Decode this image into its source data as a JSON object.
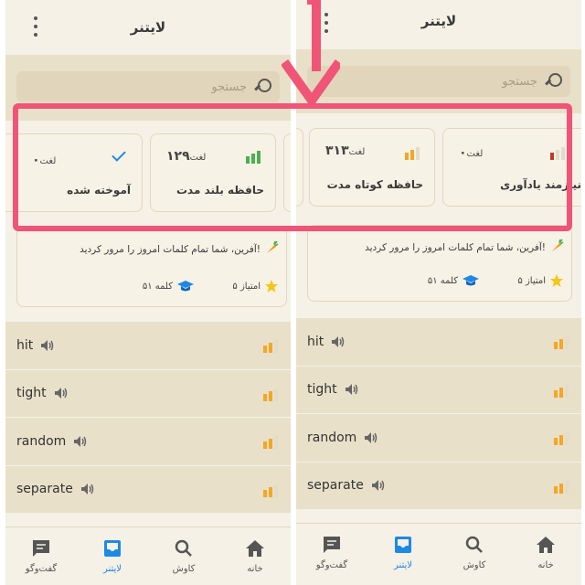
{
  "colors": {
    "accent": "#1e88e5",
    "highlight": "#f05476",
    "green": "#4caf50",
    "orange": "#f5a623",
    "red": "#c0392b"
  },
  "header": {
    "title": "لایتنر"
  },
  "search": {
    "placeholder": "جستجو"
  },
  "left": {
    "cards": [
      {
        "name": "آموخته شده",
        "unit": "لغت",
        "count": "۰",
        "icon": "check-icon"
      },
      {
        "name": "حافظه بلند مدت",
        "unit": "لغت",
        "count": "۱۲۹",
        "icon": "bars-green-icon"
      }
    ]
  },
  "right": {
    "cards": [
      {
        "name": "حافظه کوتاه مدت",
        "unit": "لغت",
        "count": "۳۱۳",
        "icon": "bars-orange-icon"
      },
      {
        "name": "نیازمند یادآوری",
        "unit": "لغت",
        "count": "۰",
        "icon": "bars-red-icon"
      }
    ]
  },
  "praise": {
    "message": "آفرین، شما تمام کلمات امروز را مرور کردید!",
    "points": "۵ امتیاز",
    "words": "۵۱ کلمه"
  },
  "words": [
    {
      "word": "hit"
    },
    {
      "word": "tight"
    },
    {
      "word": "random"
    },
    {
      "word": "separate"
    }
  ],
  "nav": {
    "chat": "گفت‌وگو",
    "leitner": "لایتنر",
    "explore": "کاوش",
    "home": "خانه"
  }
}
